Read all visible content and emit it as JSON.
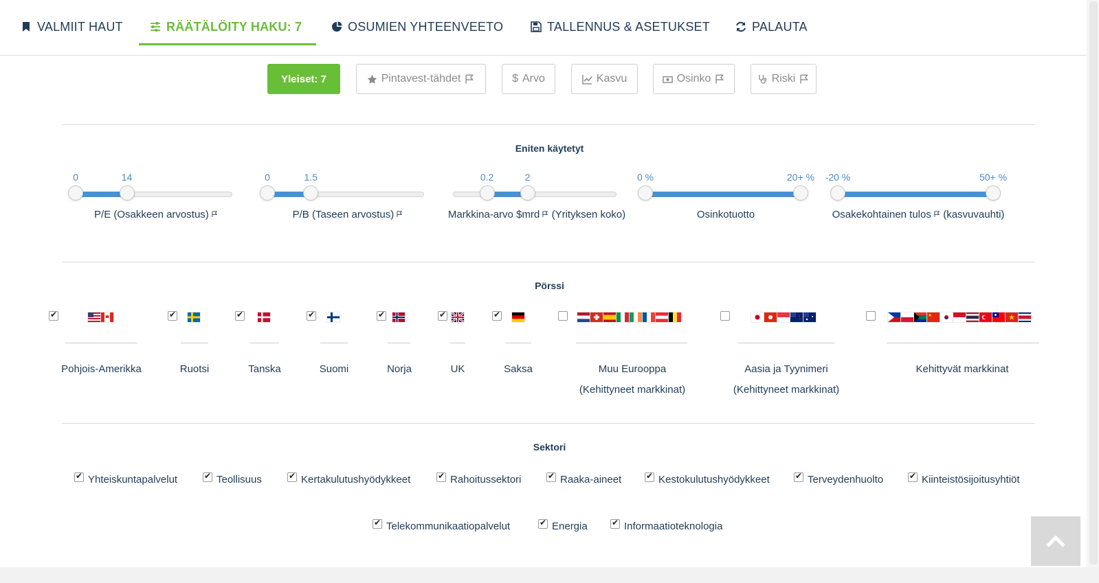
{
  "nav": {
    "tabs": [
      {
        "label": "VALMIIT HAUT",
        "icon": "bookmark-icon"
      },
      {
        "label": "RÄÄTÄLÖITY HAKU: 7",
        "icon": "sliders-icon",
        "active": true
      },
      {
        "label": "OSUMIEN YHTEENVEETO",
        "icon": "pie-chart-icon"
      },
      {
        "label": "TALLENNUS & ASETUKSET",
        "icon": "save-icon"
      },
      {
        "label": "PALAUTA",
        "icon": "refresh-icon"
      }
    ]
  },
  "filters": {
    "buttons": [
      {
        "label": "Yleiset: 7",
        "primary": true
      },
      {
        "label": "Pintavest-tähdet",
        "icon": "star-icon"
      },
      {
        "label": "Arvo",
        "icon": "dollar-icon"
      },
      {
        "label": "Kasvu",
        "icon": "line-chart-icon"
      },
      {
        "label": "Osinko",
        "icon": "money-icon"
      },
      {
        "label": "Riski",
        "icon": "stethoscope-icon"
      }
    ]
  },
  "most_used": {
    "title": "Eniten käytetyt",
    "sliders": [
      {
        "min_label": "0",
        "max_label": "14",
        "low": 0.0,
        "high": 0.33,
        "label": "P/E (Osakkeen arvostus)",
        "flag": true
      },
      {
        "min_label": "0",
        "max_label": "1.5",
        "low": 0.0,
        "high": 0.28,
        "label": "P/B (Taseen arvostus)",
        "flag": true
      },
      {
        "min_label": "0.2",
        "max_label": "2",
        "low": 0.21,
        "high": 0.46,
        "label": "Markkina-arvo $mrd",
        "label_tail": "(Yrityksen koko)",
        "flag": true
      },
      {
        "min_label": "0 %",
        "max_label": "20+ %",
        "low": 0.0,
        "high": 1.0,
        "label": "Osinkotuotto",
        "flag": false
      },
      {
        "min_label": "-20 %",
        "max_label": "50+ %",
        "low": 0.0,
        "high": 1.0,
        "label": "Osakekohtainen tulos",
        "label_tail": "(kasvuvauhti)",
        "flag": true
      }
    ]
  },
  "exchange": {
    "title": "Pörssi",
    "items": [
      {
        "name": "Pohjois-Amerikka",
        "checked": true
      },
      {
        "name": "Ruotsi",
        "checked": true
      },
      {
        "name": "Tanska",
        "checked": true
      },
      {
        "name": "Suomi",
        "checked": true
      },
      {
        "name": "Norja",
        "checked": true
      },
      {
        "name": "UK",
        "checked": true
      },
      {
        "name": "Saksa",
        "checked": true
      },
      {
        "name": "Muu Eurooppa",
        "name2": "(Kehittyneet markkinat)",
        "checked": false
      },
      {
        "name": "Aasia ja Tyynimeri",
        "name2": "(Kehittyneet markkinat)",
        "checked": false
      },
      {
        "name": "Kehittyvät markkinat",
        "checked": false
      }
    ]
  },
  "sector": {
    "title": "Sektori",
    "items": [
      {
        "label": "Yhteiskuntapalvelut",
        "checked": true
      },
      {
        "label": "Teollisuus",
        "checked": true
      },
      {
        "label": "Kertakulutushyödykkeet",
        "checked": true
      },
      {
        "label": "Rahoitussektori",
        "checked": true
      },
      {
        "label": "Raaka-aineet",
        "checked": true
      },
      {
        "label": "Kestokulutushyödykkeet",
        "checked": true
      },
      {
        "label": "Terveydenhuolto",
        "checked": true
      },
      {
        "label": "Kiinteistösijoitusyhtiöt",
        "checked": true
      },
      {
        "label": "Telekommunikaatiopalvelut",
        "checked": true
      },
      {
        "label": "Energia",
        "checked": true
      },
      {
        "label": "Informaatioteknologia",
        "checked": true
      }
    ]
  },
  "colors": {
    "accent": "#69be38",
    "slider": "#4a90d2",
    "text": "#1f3b57"
  }
}
